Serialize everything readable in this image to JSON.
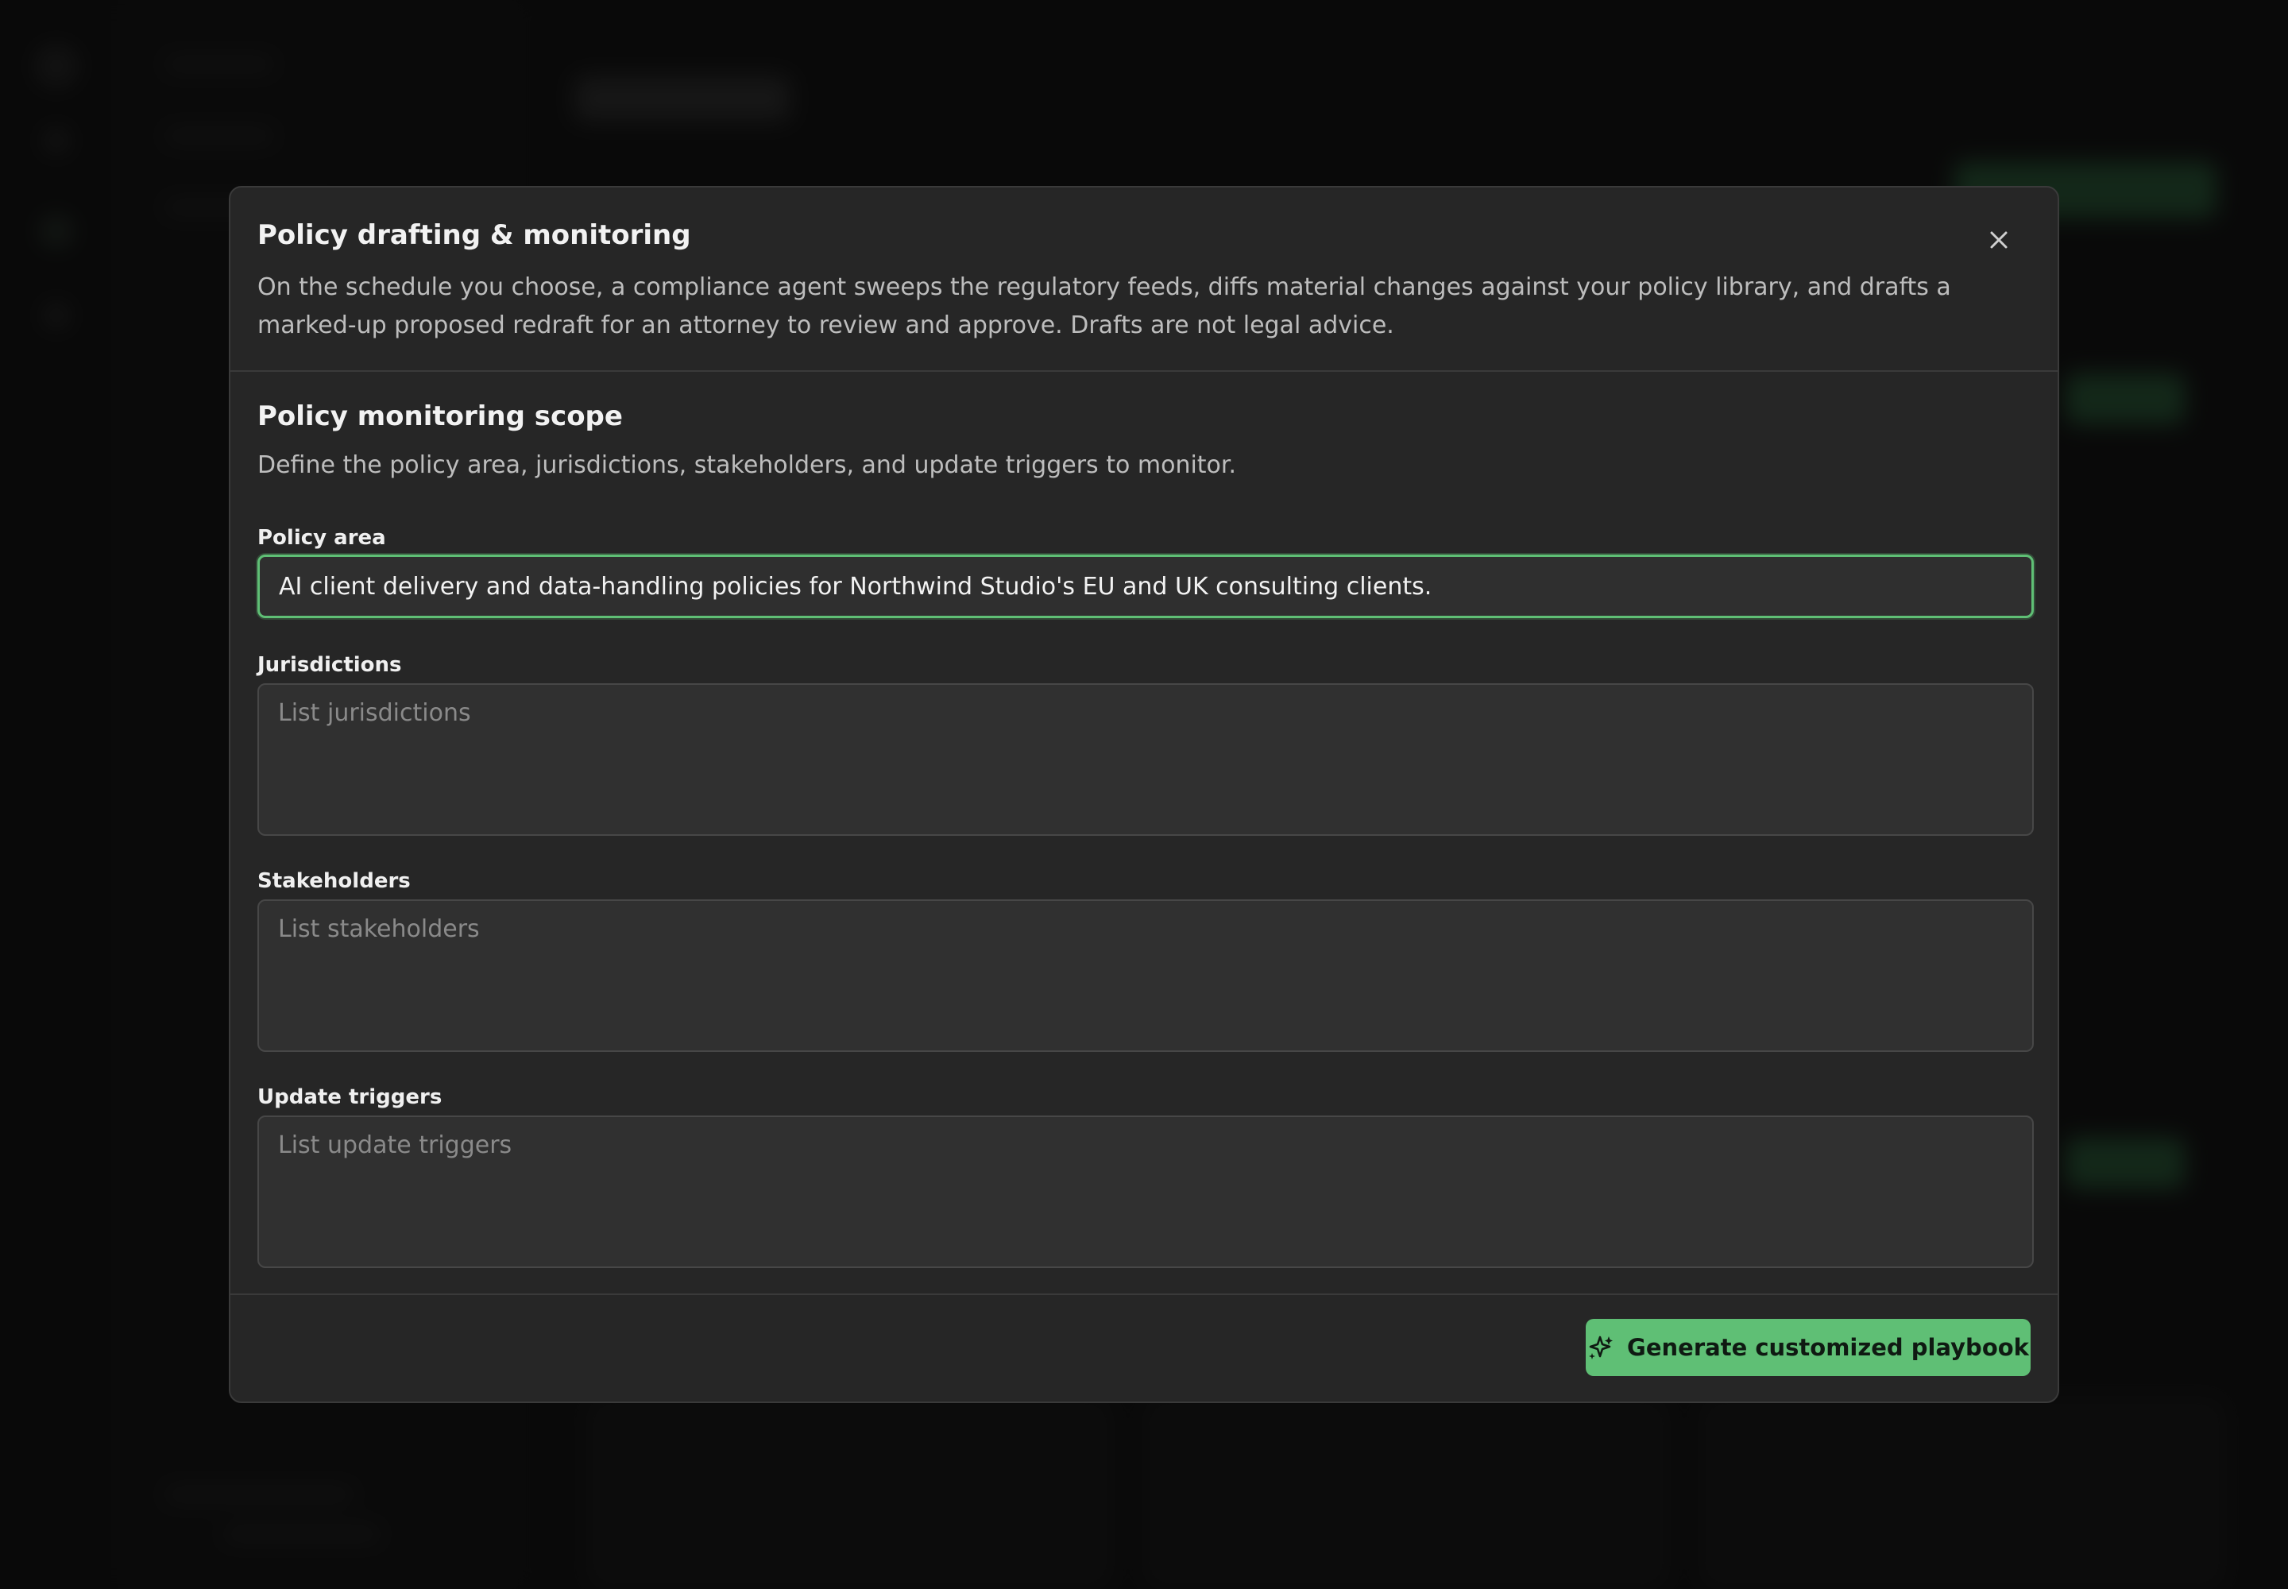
{
  "modal": {
    "title": "Policy drafting & monitoring",
    "description": "On the schedule you choose, a compliance agent sweeps the regulatory feeds, diffs material changes against your policy library, and drafts a marked-up proposed redraft for an attorney to review and approve. Drafts are not legal advice.",
    "close_icon": "close-icon"
  },
  "scope": {
    "title": "Policy monitoring scope",
    "description": "Define the policy area, jurisdictions, stakeholders, and update triggers to monitor."
  },
  "fields": {
    "policy_area": {
      "label": "Policy area",
      "value": "AI client delivery and data-handling policies for Northwind Studio's EU and UK consulting clients."
    },
    "jurisdictions": {
      "label": "Jurisdictions",
      "placeholder": "List jurisdictions"
    },
    "stakeholders": {
      "label": "Stakeholders",
      "placeholder": "List stakeholders"
    },
    "update_triggers": {
      "label": "Update triggers",
      "placeholder": "List update triggers"
    }
  },
  "footer": {
    "generate_label": "Generate customized playbook",
    "generate_icon": "sparkle-icon"
  },
  "colors": {
    "accent": "#5fbf75",
    "modal_bg": "#262626",
    "backdrop": "#141414"
  }
}
